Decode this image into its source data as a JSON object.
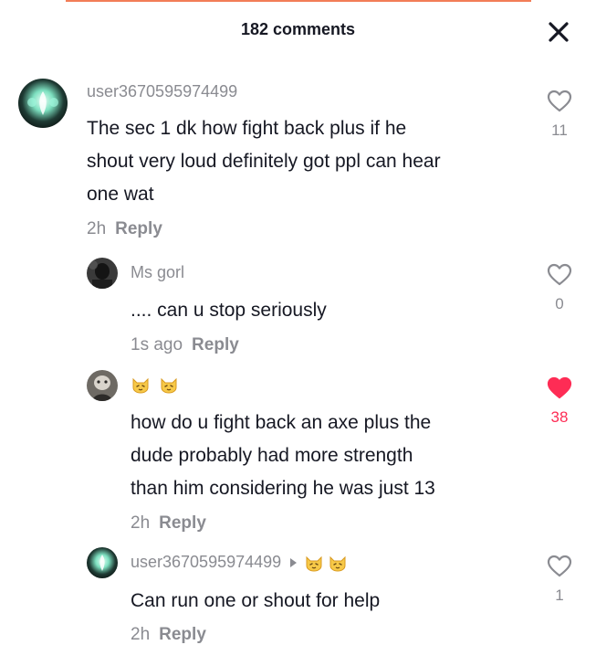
{
  "header": {
    "title": "182 comments"
  },
  "comments": [
    {
      "username": "user3670595974499",
      "text_lines": [
        "The sec 1 dk how fight back plus if he",
        "shout very loud definitely got ppl can hear",
        "one wat"
      ],
      "time": "2h",
      "reply": "Reply",
      "likes": "11",
      "liked": false
    },
    {
      "username": "Ms gorl",
      "text_lines": [
        ".... can u stop seriously"
      ],
      "time": "1s ago",
      "reply": "Reply",
      "likes": "0",
      "liked": false
    },
    {
      "username": "",
      "text_lines": [
        "how do u fight back an axe plus the",
        "dude probably had more strength",
        "than him considering he was just 13"
      ],
      "time": "2h",
      "reply": "Reply",
      "likes": "38",
      "liked": true
    },
    {
      "username": "user3670595974499",
      "text_lines": [
        "Can run one or shout for help"
      ],
      "time": "2h",
      "reply": "Reply",
      "likes": "1",
      "liked": false
    }
  ],
  "colors": {
    "liked": "#fe2c55",
    "muted": "#8a8b91",
    "text": "#161823"
  },
  "icons": {
    "close": "close-icon",
    "like": "heart-icon",
    "name_emoji": "cat-face-emoji",
    "reply_arrow": "reply-arrow-icon"
  }
}
